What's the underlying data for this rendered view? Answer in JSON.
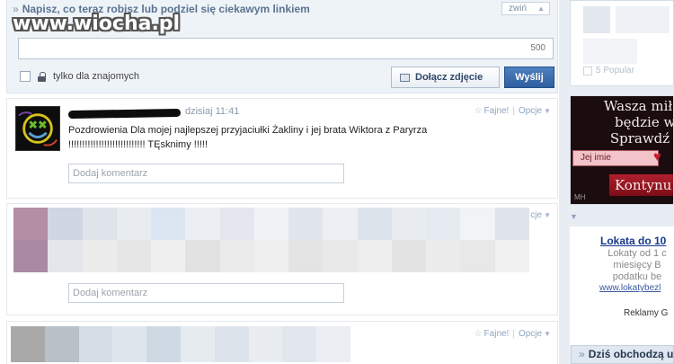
{
  "composer": {
    "title": "Napisz, co teraz robisz lub podziel się ciekawym linkiem",
    "collapse_label": "zwiń",
    "char_count": "500",
    "friends_only_label": "tylko dla znajomych",
    "attach_photo_label": "Dołącz zdjęcie",
    "send_label": "Wyślij"
  },
  "posts": [
    {
      "time": "dzisiaj 11:41",
      "like_label": "Fajne!",
      "options_label": "Opcje",
      "text": "Pozdrowienia Dla mojej najlepszej przyjaciułki Żakliny i jej brata Wiktora z Paryrza !!!!!!!!!!!!!!!!!!!!!!!!!!!! TĘsknimy !!!!!",
      "comment_placeholder": "Dodaj komentarz"
    },
    {
      "options_label": "cje",
      "comment_placeholder": "Dodaj komentarz"
    },
    {
      "like_label": "Fajne!",
      "options_label": "Opcje"
    }
  ],
  "sidebar": {
    "popular_label": "5 Popular",
    "ad": {
      "headline": "Wasza miłoś\nbędzie wie\nSprawdź to",
      "name_field": "Jej imie",
      "continue_label": "Kontynu",
      "mark": "MH"
    },
    "lokata": {
      "title": "Lokata do 10",
      "body": "Lokaty od 1 c miesięcy B podatku be",
      "url": "www.lokatybezl",
      "ads_label": "Reklamy G"
    },
    "today_label": "Dziś obchodzą u"
  },
  "watermark": "www.wiocha.pl",
  "colors": {
    "accent": "#2e5f9e",
    "link": "#15398a",
    "panel": "#eef3f8"
  }
}
